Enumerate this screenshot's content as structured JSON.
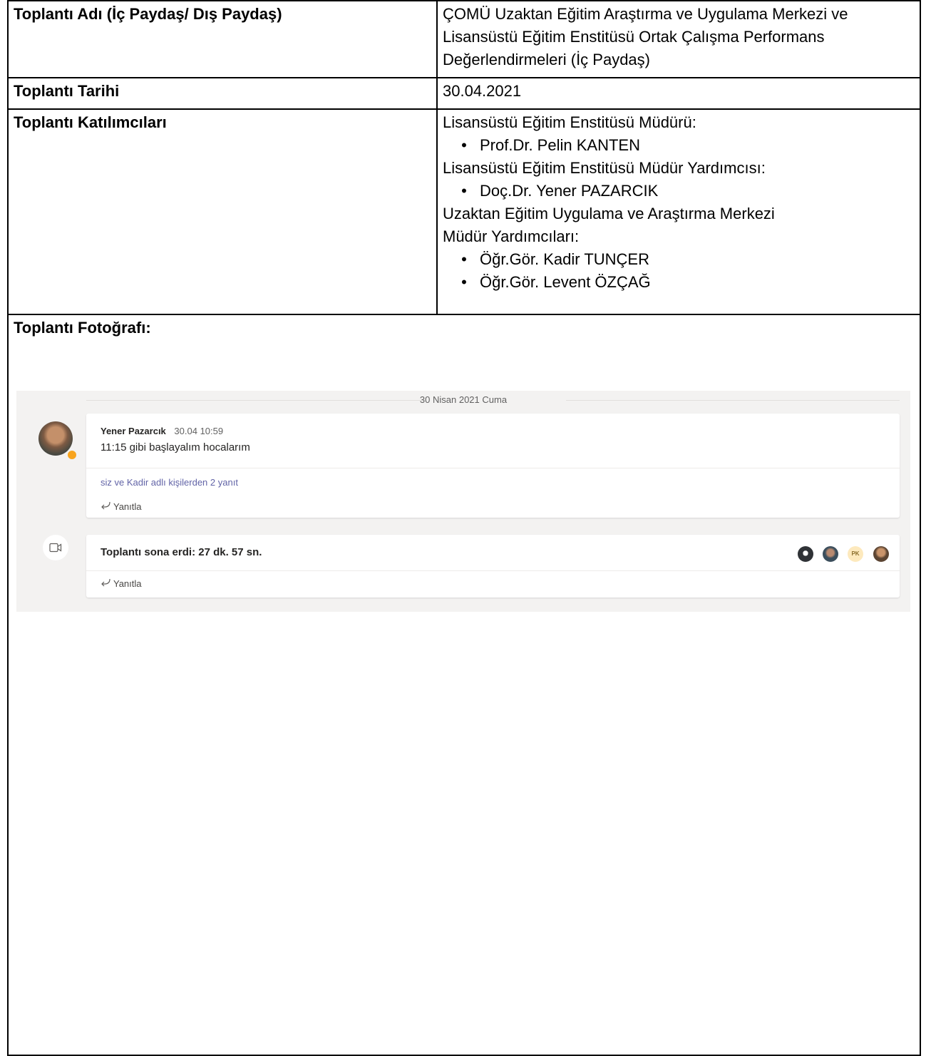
{
  "form": {
    "meeting_name_label": "Toplantı Adı (İç Paydaş/ Dış Paydaş)",
    "meeting_name_value": "ÇOMÜ Uzaktan Eğitim Araştırma ve Uygulama Merkezi ve Lisansüstü Eğitim Enstitüsü Ortak Çalışma Performans Değerlendirmeleri (İç Paydaş)",
    "meeting_date_label": "Toplantı Tarihi",
    "meeting_date_value": "30.04.2021",
    "participants_label": "Toplantı Katılımcıları",
    "participants": {
      "group1_title": "Lisansüstü Eğitim Enstitüsü Müdürü:",
      "group1_person1": "Prof.Dr. Pelin KANTEN",
      "group2_title": "Lisansüstü Eğitim Enstitüsü Müdür Yardımcısı:",
      "group2_person1": "Doç.Dr. Yener PAZARCIK",
      "group3_title_line1": "Uzaktan Eğitim Uygulama ve Araştırma Merkezi",
      "group3_title_line2": "Müdür Yardımcıları:",
      "group3_person1": "Öğr.Gör. Kadir TUNÇER",
      "group3_person2": "Öğr.Gör. Levent ÖZÇAĞ"
    },
    "photo_label": "Toplantı Fotoğrafı:"
  },
  "teams": {
    "date_separator": "30 Nisan 2021 Cuma",
    "message": {
      "author": "Yener Pazarcık",
      "timestamp": "30.04 10:59",
      "text": "11:15 gibi başlayalım hocalarım",
      "replies_link": "siz ve Kadir adlı kişilerden 2 yanıt",
      "reply_label": "Yanıtla"
    },
    "meeting": {
      "ended_text": "Toplantı sona erdi: 27 dk. 57 sn.",
      "reply_label": "Yanıtla",
      "participant_initials": "PK"
    },
    "colors": {
      "background": "#f3f2f1",
      "link": "#6264a7",
      "status_away": "#f8a41d"
    }
  }
}
